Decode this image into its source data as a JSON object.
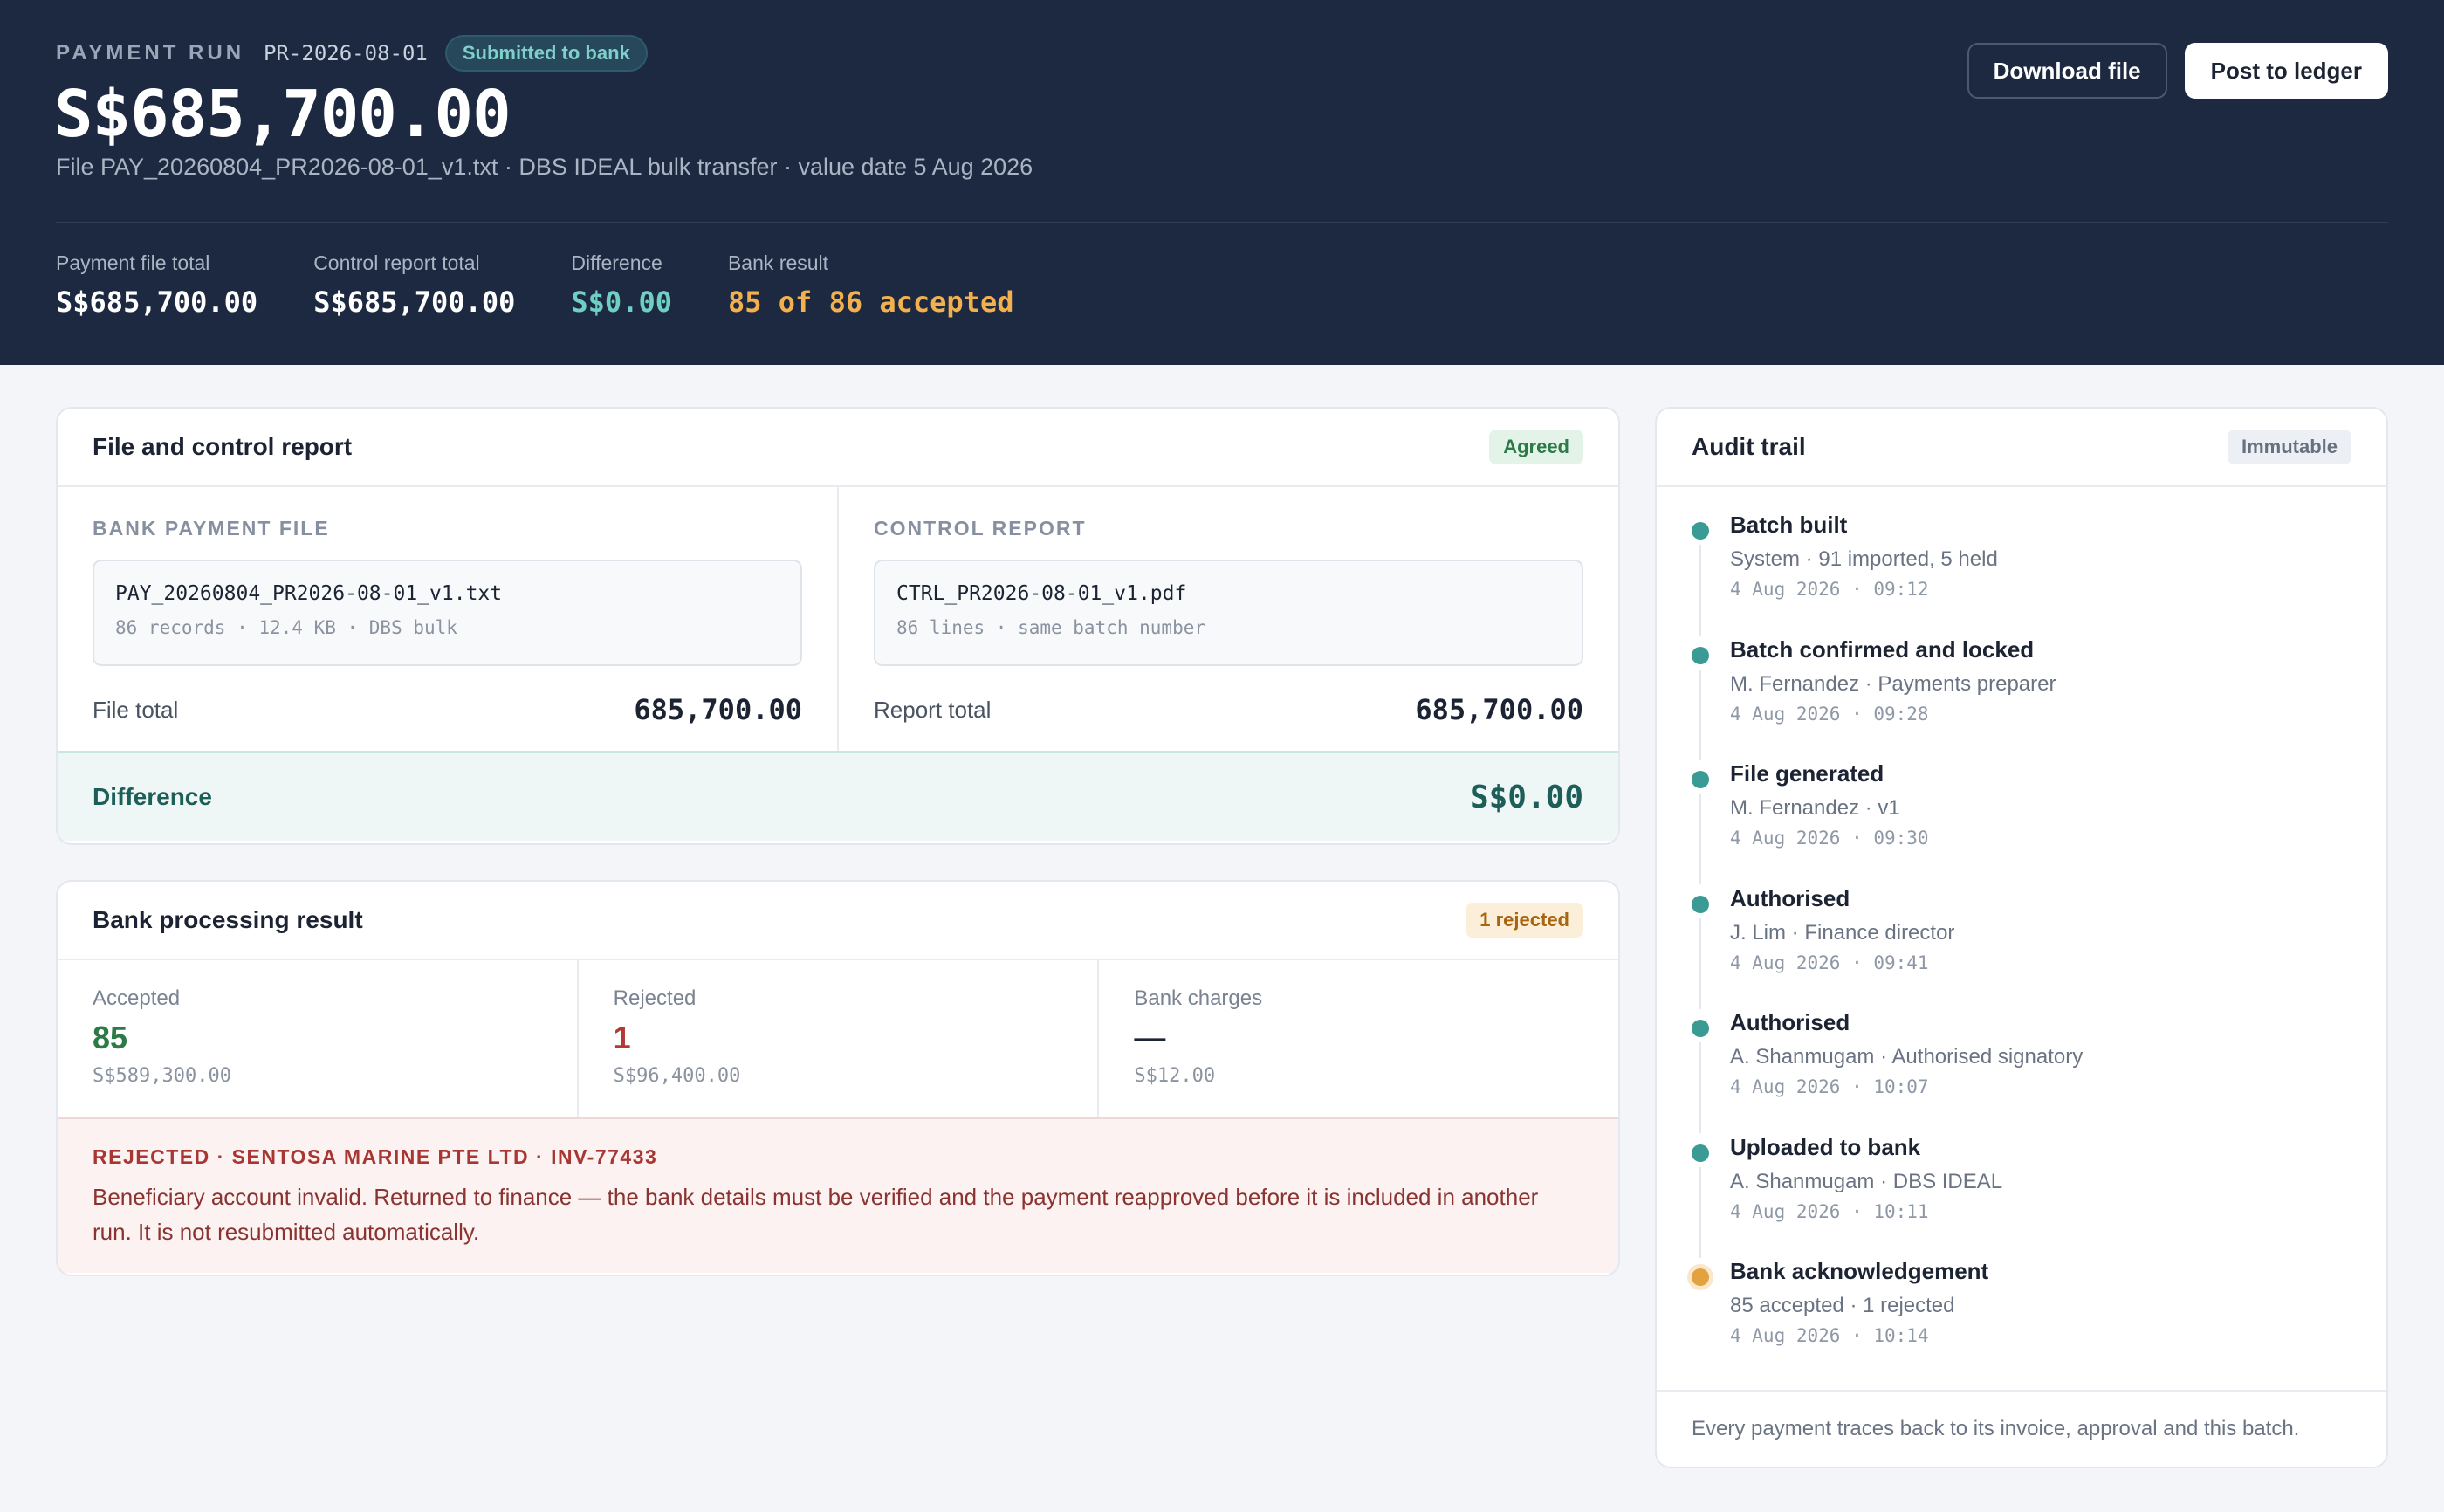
{
  "header": {
    "kicker": "PAYMENT RUN",
    "run_id": "PR-2026-08-01",
    "status_badge": "Submitted to bank",
    "amount": "S$685,700.00",
    "subtitle": "File PAY_20260804_PR2026-08-01_v1.txt · DBS IDEAL bulk transfer · value date 5 Aug 2026",
    "download_label": "Download file",
    "post_label": "Post to ledger",
    "stats": [
      {
        "label": "Payment file total",
        "value": "S$685,700.00"
      },
      {
        "label": "Control report total",
        "value": "S$685,700.00"
      },
      {
        "label": "Difference",
        "value": "S$0.00"
      },
      {
        "label": "Bank result",
        "value": "85 of 86 accepted"
      }
    ]
  },
  "file_control": {
    "title": "File and control report",
    "badge": "Agreed",
    "bank_file": {
      "label": "BANK PAYMENT FILE",
      "name": "PAY_20260804_PR2026-08-01_v1.txt",
      "meta": "86 records · 12.4 KB · DBS bulk",
      "total_label": "File total",
      "total": "685,700.00"
    },
    "control_report": {
      "label": "CONTROL REPORT",
      "name": "CTRL_PR2026-08-01_v1.pdf",
      "meta": "86 lines · same batch number",
      "total_label": "Report total",
      "total": "685,700.00"
    },
    "difference_label": "Difference",
    "difference_value": "S$0.00"
  },
  "bank_processing": {
    "title": "Bank processing result",
    "badge": "1 rejected",
    "accepted": {
      "label": "Accepted",
      "value": "85",
      "sub": "S$589,300.00"
    },
    "rejected": {
      "label": "Rejected",
      "value": "1",
      "sub": "S$96,400.00"
    },
    "charges": {
      "label": "Bank charges",
      "value": "—",
      "sub": "S$12.00"
    },
    "rejection_title": "REJECTED · SENTOSA MARINE PTE LTD · INV-77433",
    "rejection_text": "Beneficiary account invalid. Returned to finance — the bank details must be verified and the payment reapproved before it is included in another run. It is not resubmitted automatically."
  },
  "audit": {
    "title": "Audit trail",
    "badge": "Immutable",
    "items": [
      {
        "title": "Batch built",
        "sub": "System · 91 imported, 5 held",
        "time": "4 Aug 2026 · 09:12",
        "status": "done"
      },
      {
        "title": "Batch confirmed and locked",
        "sub": "M. Fernandez · Payments preparer",
        "time": "4 Aug 2026 · 09:28",
        "status": "done"
      },
      {
        "title": "File generated",
        "sub": "M. Fernandez · v1",
        "time": "4 Aug 2026 · 09:30",
        "status": "done"
      },
      {
        "title": "Authorised",
        "sub": "J. Lim · Finance director",
        "time": "4 Aug 2026 · 09:41",
        "status": "done"
      },
      {
        "title": "Authorised",
        "sub": "A. Shanmugam · Authorised signatory",
        "time": "4 Aug 2026 · 10:07",
        "status": "done"
      },
      {
        "title": "Uploaded to bank",
        "sub": "A. Shanmugam · DBS IDEAL",
        "time": "4 Aug 2026 · 10:11",
        "status": "done"
      },
      {
        "title": "Bank acknowledgement",
        "sub": "85 accepted · 1 rejected",
        "time": "4 Aug 2026 · 10:14",
        "status": "warning"
      }
    ],
    "footer": "Every payment traces back to its invoice, approval and this batch."
  },
  "colors": {
    "header_bg": "#1c2940",
    "accent_teal": "#3a9b94",
    "accent_amber": "#e1a23f",
    "reject_red": "#b23a36",
    "accept_green": "#2d7a47"
  }
}
